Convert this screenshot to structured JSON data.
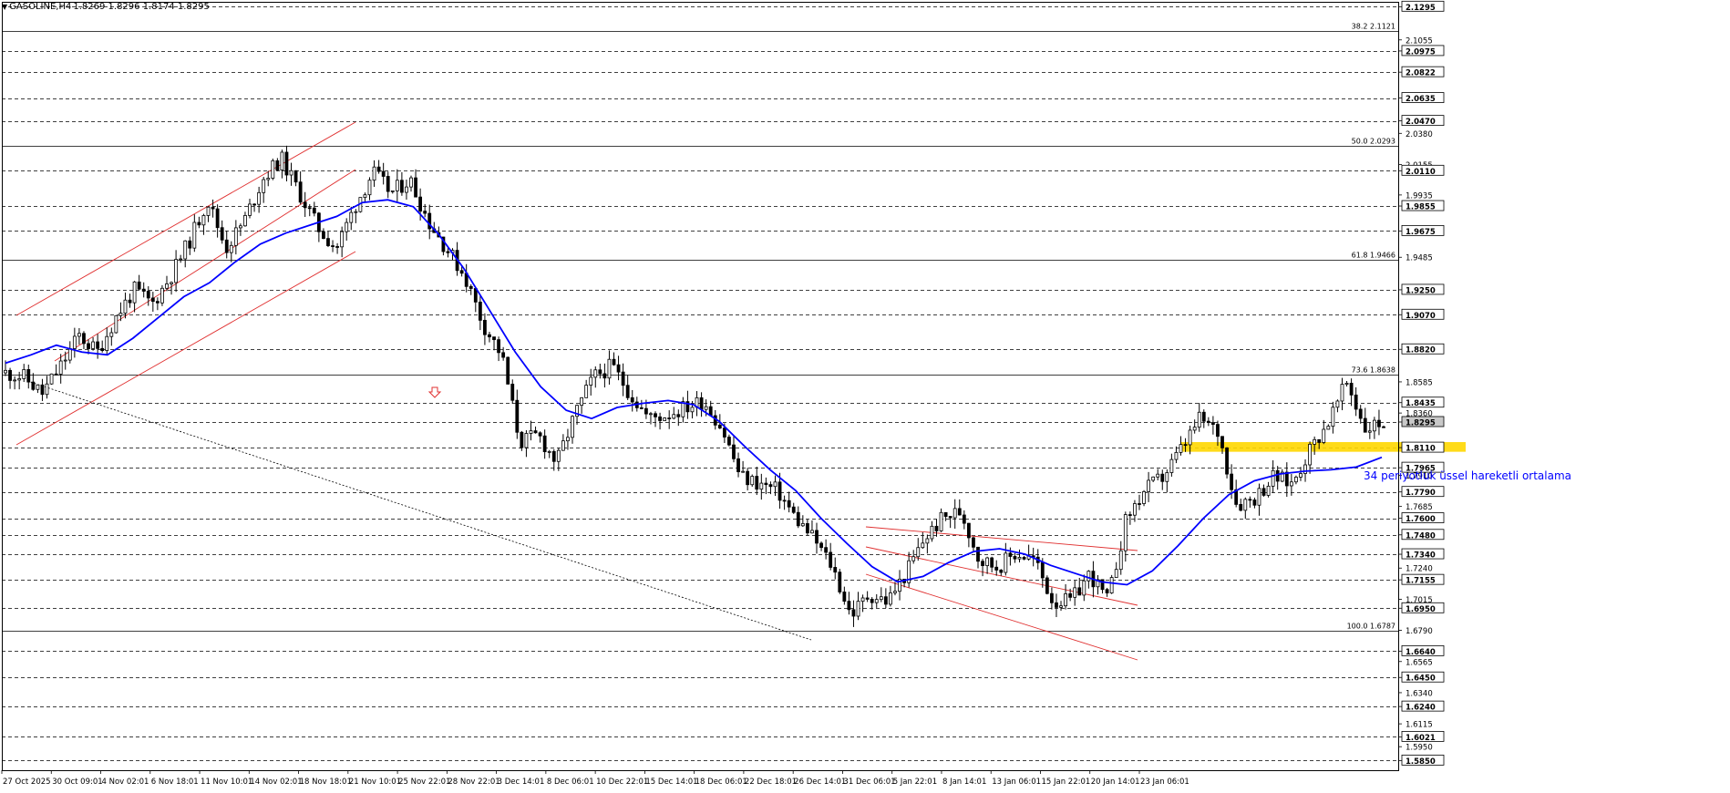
{
  "header": {
    "symbol": "GASOLINE,H4",
    "ohlc": "1.8269 1.8296 1.8174 1.8295"
  },
  "annotations": {
    "ema_label": "34 periyotluk üssel hareketli ortalama"
  },
  "colors": {
    "candle": "#000000",
    "ema": "#0000ff",
    "channel": "#e03030",
    "support_zone": "#ffd700",
    "fib_line": "#000000",
    "grid": "#000000",
    "arrow": "#e03030"
  },
  "icons": {
    "down_arrow": "down-arrow-icon",
    "header_triangle": "triangle-down-icon"
  },
  "chart_data": {
    "type": "candlestick",
    "x_ticks": [
      "27 Oct 2025",
      "30 Oct 09:01",
      "4 Nov 02:01",
      "6 Nov 18:01",
      "11 Nov 10:01",
      "14 Nov 02:01",
      "18 Nov 18:01",
      "21 Nov 10:01",
      "25 Nov 22:01",
      "28 Nov 22:01",
      "3 Dec 14:01",
      "8 Dec 06:01",
      "10 Dec 22:01",
      "15 Dec 14:01",
      "18 Dec 06:01",
      "22 Dec 18:01",
      "26 Dec 14:01",
      "31 Dec 06:01",
      "5 Jan 22:01",
      "8 Jan 14:01",
      "13 Jan 06:01",
      "15 Jan 22:01",
      "20 Jan 14:01",
      "23 Jan 06:01"
    ],
    "y_ticks": [
      "2.1295",
      "2.1055",
      "2.0975",
      "2.0822",
      "2.0635",
      "2.0470",
      "2.0380",
      "2.0155",
      "2.0110",
      "1.9935",
      "1.9855",
      "1.9675",
      "1.9485",
      "1.9250",
      "1.9070",
      "1.8820",
      "1.8585",
      "1.8435",
      "1.8360",
      "1.8295",
      "1.8110",
      "1.7965",
      "1.7910",
      "1.7790",
      "1.7685",
      "1.7600",
      "1.7480",
      "1.7340",
      "1.7240",
      "1.7155",
      "1.7015",
      "1.6950",
      "1.6790",
      "1.6640",
      "1.6565",
      "1.6450",
      "1.6340",
      "1.6240",
      "1.6115",
      "1.6021",
      "1.5950",
      "1.5850"
    ],
    "y_ticks_boxed": [
      "2.1295",
      "2.0975",
      "2.0822",
      "2.0635",
      "2.0470",
      "2.0110",
      "1.9855",
      "1.9675",
      "1.9250",
      "1.9070",
      "1.8820",
      "1.8435",
      "1.8295",
      "1.8110",
      "1.7965",
      "1.7790",
      "1.7600",
      "1.7480",
      "1.7340",
      "1.7155",
      "1.6950",
      "1.6640",
      "1.6450",
      "1.6240",
      "1.6021",
      "1.5850"
    ],
    "ylim": [
      1.578,
      2.133
    ],
    "fibonacci": [
      {
        "label": "38.2 2.1121",
        "value": 2.1121
      },
      {
        "label": "50.0 2.0293",
        "value": 2.0293
      },
      {
        "label": "61.8 1.9466",
        "value": 1.9466
      },
      {
        "label": "73.6 1.8638",
        "value": 1.8638
      },
      {
        "label": "100.0 1.6787",
        "value": 1.6787
      }
    ],
    "current_price": 1.8295,
    "support_zone": [
      1.808,
      1.815
    ],
    "close_path": [
      1.865,
      1.862,
      1.85,
      1.87,
      1.892,
      1.88,
      1.905,
      1.925,
      1.915,
      1.935,
      1.96,
      1.99,
      1.955,
      1.975,
      2.005,
      2.02,
      1.995,
      1.97,
      1.955,
      1.985,
      2.01,
      1.995,
      2.005,
      1.975,
      1.955,
      1.935,
      1.9,
      1.878,
      1.815,
      1.82,
      1.8,
      1.835,
      1.862,
      1.87,
      1.85,
      1.832,
      1.835,
      1.84,
      1.845,
      1.825,
      1.79,
      1.785,
      1.78,
      1.76,
      1.745,
      1.725,
      1.69,
      1.705,
      1.7,
      1.72,
      1.745,
      1.76,
      1.765,
      1.73,
      1.725,
      1.735,
      1.73,
      1.7,
      1.7,
      1.72,
      1.7,
      1.76,
      1.78,
      1.79,
      1.81,
      1.832,
      1.822,
      1.77,
      1.775,
      1.79,
      1.785,
      1.81,
      1.83,
      1.858,
      1.825,
      1.8295
    ],
    "ema_path": [
      1.872,
      1.878,
      1.885,
      1.88,
      1.878,
      1.89,
      1.905,
      1.92,
      1.93,
      1.945,
      1.958,
      1.966,
      1.972,
      1.978,
      1.988,
      1.99,
      1.985,
      1.965,
      1.94,
      1.91,
      1.88,
      1.855,
      1.838,
      1.832,
      1.84,
      1.843,
      1.845,
      1.842,
      1.83,
      1.812,
      1.795,
      1.78,
      1.76,
      1.742,
      1.725,
      1.714,
      1.718,
      1.728,
      1.736,
      1.738,
      1.734,
      1.726,
      1.72,
      1.714,
      1.712,
      1.722,
      1.74,
      1.76,
      1.777,
      1.787,
      1.792,
      1.794,
      1.795,
      1.797,
      1.804
    ]
  }
}
